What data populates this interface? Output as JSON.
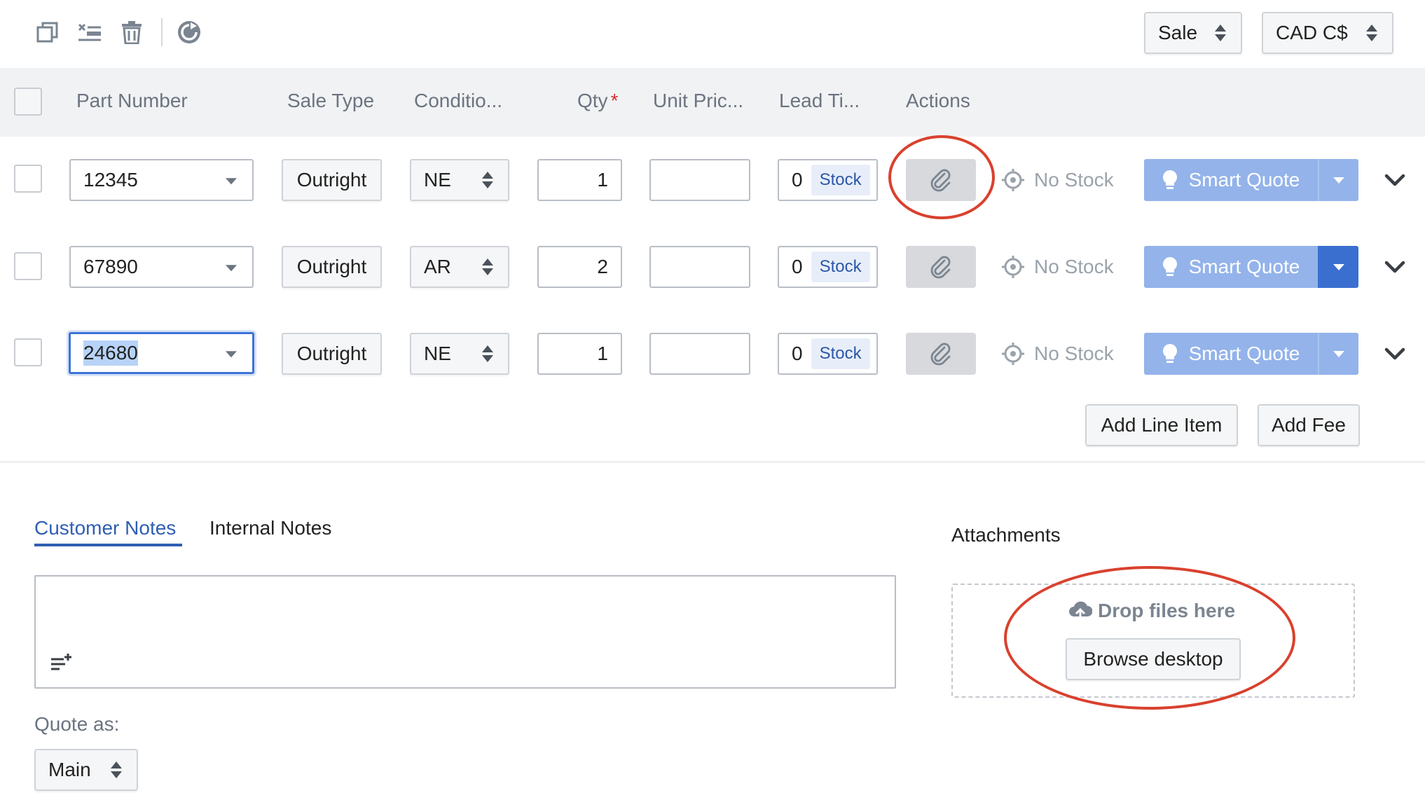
{
  "toolbar": {
    "icons": [
      "copy-icon",
      "clear-rows-icon",
      "trash-icon",
      "refresh-icon"
    ],
    "type_select": "Sale",
    "currency_select": "CAD C$"
  },
  "table": {
    "headers": {
      "part_number": "Part Number",
      "sale_type": "Sale Type",
      "condition": "Conditio...",
      "qty": "Qty",
      "qty_required_mark": "*",
      "unit_price": "Unit Pric...",
      "lead_time": "Lead Ti...",
      "actions": "Actions"
    },
    "rows": [
      {
        "part_number": "12345",
        "sale_type": "Outright",
        "condition": "NE",
        "qty": "1",
        "unit_price": "",
        "lead_time": "0",
        "lead_unit": "Stock",
        "stock_status": "No Stock",
        "smart_quote": "Smart Quote"
      },
      {
        "part_number": "67890",
        "sale_type": "Outright",
        "condition": "AR",
        "qty": "2",
        "unit_price": "",
        "lead_time": "0",
        "lead_unit": "Stock",
        "stock_status": "No Stock",
        "smart_quote": "Smart Quote"
      },
      {
        "part_number": "24680",
        "sale_type": "Outright",
        "condition": "NE",
        "qty": "1",
        "unit_price": "",
        "lead_time": "0",
        "lead_unit": "Stock",
        "stock_status": "No Stock",
        "smart_quote": "Smart Quote"
      }
    ],
    "add_line_item": "Add Line Item",
    "add_fee": "Add Fee"
  },
  "notes": {
    "tabs": [
      "Customer Notes",
      "Internal Notes"
    ],
    "active_tab": "Customer Notes",
    "value": ""
  },
  "quote_as": {
    "label": "Quote as:",
    "value": "Main"
  },
  "attachments": {
    "title": "Attachments",
    "drop_text": "Drop files here",
    "browse_button": "Browse desktop"
  },
  "colors": {
    "accent": "#2f5fb3",
    "smart_quote": "#93b3ea",
    "smart_quote_active": "#3a6fd0",
    "annotation": "#d9412e"
  }
}
